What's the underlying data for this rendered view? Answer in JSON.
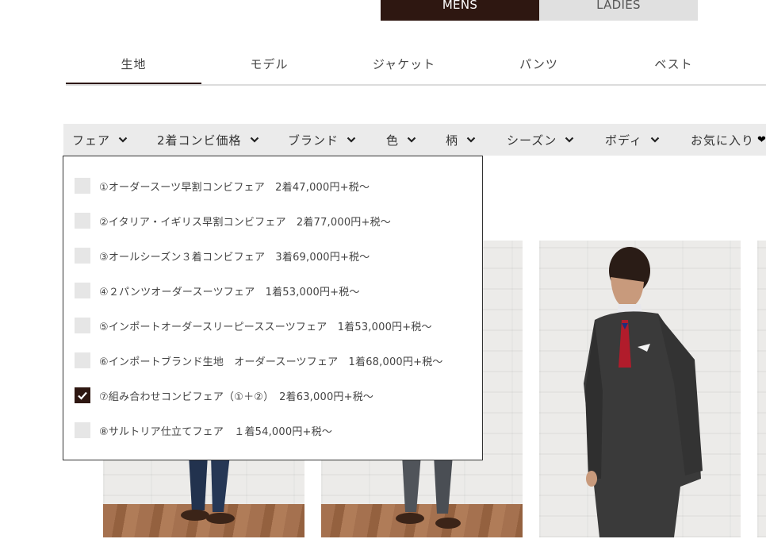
{
  "gender": {
    "mens": "MENS",
    "ladies": "LADIES"
  },
  "tabs": [
    "生地",
    "モデル",
    "ジャケット",
    "パンツ",
    "ベスト"
  ],
  "filters": [
    "フェア",
    "2着コンビ価格",
    "ブランド",
    "色",
    "柄",
    "シーズン",
    "ボディ",
    "お気に入り"
  ],
  "fair_options": [
    {
      "label": "①オーダースーツ早割コンビフェア　2着47,000円+税～",
      "checked": false
    },
    {
      "label": "②イタリア・イギリス早割コンビフェア　2着77,000円+税～",
      "checked": false
    },
    {
      "label": "③オールシーズン３着コンビフェア　3着69,000円+税～",
      "checked": false
    },
    {
      "label": "④２パンツオーダースーツフェア　1着53,000円+税～",
      "checked": false
    },
    {
      "label": "⑤インポートオーダースリーピーススーツフェア　1着53,000円+税～",
      "checked": false
    },
    {
      "label": "⑥インポートブランド生地　オーダースーツフェア　1着68,000円+税～",
      "checked": false
    },
    {
      "label": "⑦組み合わせコンビフェア（①＋②）　2着63,000円+税～",
      "checked": true
    },
    {
      "label": "⑧サルトリア仕立てフェア　１着54,000円+税～",
      "checked": false
    }
  ],
  "colors": {
    "accent": "#2e1711",
    "filter_bg": "#ebebeb",
    "checkbox_bg": "#e6e6e6"
  },
  "icons": {
    "filter_chevron": "chevron-down-icon",
    "favorite": "heart-icon",
    "checkbox": "check-icon"
  }
}
